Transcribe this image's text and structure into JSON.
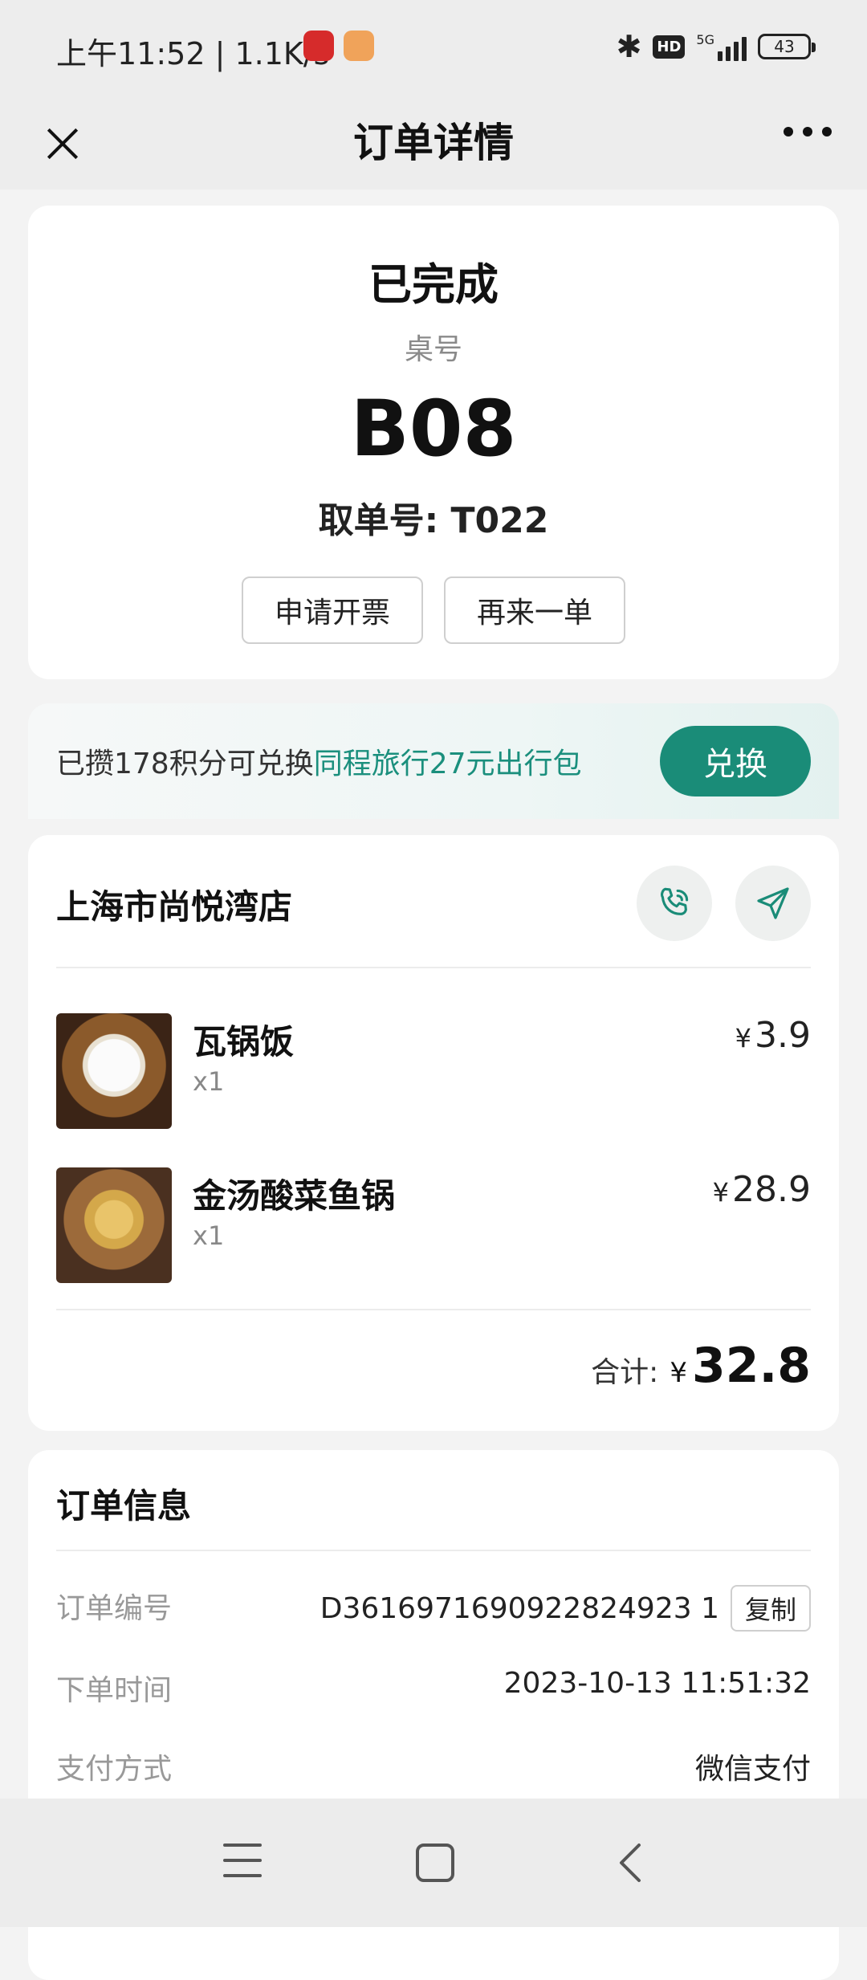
{
  "status_bar": {
    "time": "上午11:52 | 1.1K/s",
    "network": "5G",
    "hd": "HD",
    "battery": "43"
  },
  "nav": {
    "title": "订单详情"
  },
  "order": {
    "status": "已完成",
    "table_label": "桌号",
    "table_no": "B08",
    "pickup": "取单号: T022",
    "buttons": {
      "invoice": "申请开票",
      "reorder": "再来一单"
    }
  },
  "promo": {
    "text": "已攒178积分可兑换",
    "highlight": "同程旅行27元出行包",
    "button": "兑换"
  },
  "store": {
    "name": "上海市尚悦湾店",
    "items": [
      {
        "name": "瓦锅饭",
        "qty": "x1",
        "currency": "¥",
        "price": "3.9"
      },
      {
        "name": "金汤酸菜鱼锅",
        "qty": "x1",
        "currency": "¥",
        "price": "28.9"
      }
    ],
    "total_label": "合计:",
    "total_currency": "¥",
    "total": "32.8"
  },
  "order_info": {
    "title": "订单信息",
    "rows": [
      {
        "key": "订单编号",
        "value": "D3616971690922824923 1"
      },
      {
        "key": "下单时间",
        "value": "2023-10-13 11:51:32"
      },
      {
        "key": "支付方式",
        "value": "微信支付"
      }
    ],
    "copy_label": "复制"
  },
  "colors": {
    "accent": "#1a8c78",
    "highlight_text": "#1b8f7d",
    "page_bg": "#f3f3f3"
  }
}
